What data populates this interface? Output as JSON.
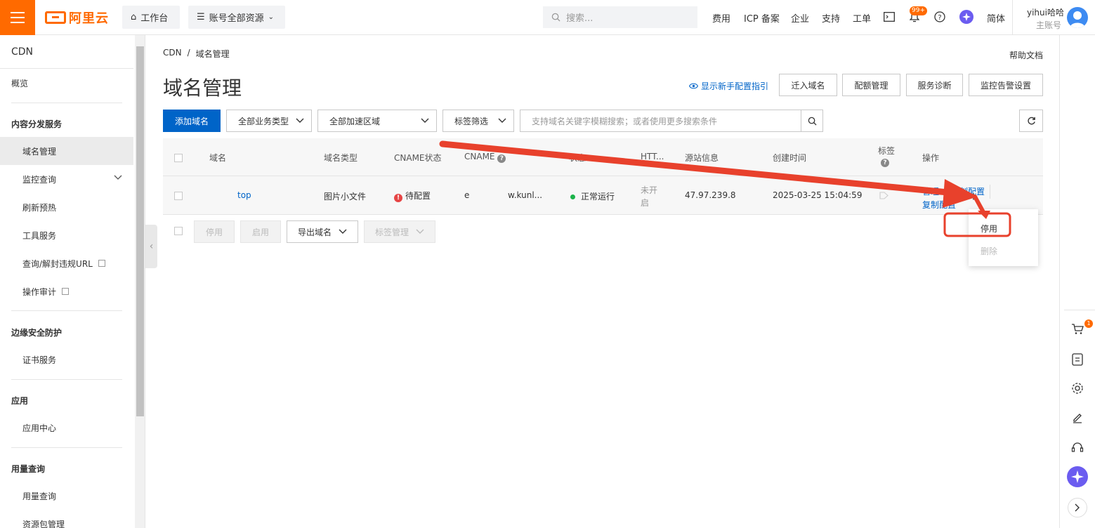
{
  "topbar": {
    "logo_text": "阿里云",
    "workbench": "工作台",
    "resources": "账号全部资源",
    "search_placeholder": "搜索...",
    "links": [
      "费用",
      "ICP 备案",
      "企业",
      "支持",
      "工单"
    ],
    "notification_badge": "99+",
    "lang": "简体",
    "user_name": "yihui哈哈",
    "user_role": "主账号"
  },
  "sidebar": {
    "title": "CDN",
    "overview": "概览",
    "groups": {
      "content": "内容分发服务",
      "edge": "边缘安全防护",
      "app": "应用",
      "usage": "用量查询"
    },
    "items": {
      "domain_mgmt": "域名管理",
      "monitor": "监控查询",
      "refresh": "刷新预热",
      "tools": "工具服务",
      "url_query": "查询/解封违规URL",
      "audit": "操作审计",
      "cert": "证书服务",
      "app_center": "应用中心",
      "usage_query": "用量查询",
      "package_mgmt": "资源包管理"
    }
  },
  "main": {
    "breadcrumb": [
      "CDN",
      "/",
      "域名管理"
    ],
    "help": "帮助文档",
    "title": "域名管理",
    "guide_link": "显示新手配置指引",
    "header_buttons": [
      "迁入域名",
      "配额管理",
      "服务诊断",
      "监控告警设置"
    ],
    "add_domain": "添加域名",
    "filter_type": "全部业务类型",
    "filter_region": "全部加速区域",
    "filter_tag": "标签筛选",
    "search_placeholder": "支持域名关键字模糊搜索；或者使用更多搜索条件",
    "columns": [
      "域名",
      "域名类型",
      "CNAME状态",
      "CNAME",
      "状态",
      "HTT...",
      "源站信息",
      "创建时间",
      "标签",
      "操作"
    ],
    "row": {
      "domain": "top",
      "type": "图片小文件",
      "cname_status": "待配置",
      "cname_prefix": "e",
      "cname_suffix": "w.kunl...",
      "status": "正常运行",
      "https_1": "未开",
      "https_2": "启",
      "origin": "47.97.239.8",
      "created": "2025-03-25 15:04:59",
      "op_manage": "管理",
      "op_copy_config": "复制配置",
      "op_copy_config2": "复制配置"
    },
    "footer_buttons": {
      "disable": "停用",
      "enable": "启用",
      "export": "导出域名",
      "tag_mgmt": "标签管理"
    },
    "dropdown": {
      "disable": "停用",
      "delete": "删除"
    }
  },
  "right_rail": {
    "cart_badge": "1"
  },
  "colors": {
    "brand": "#ff6a00",
    "primary": "#0064c8",
    "annotation": "#e8412c"
  }
}
